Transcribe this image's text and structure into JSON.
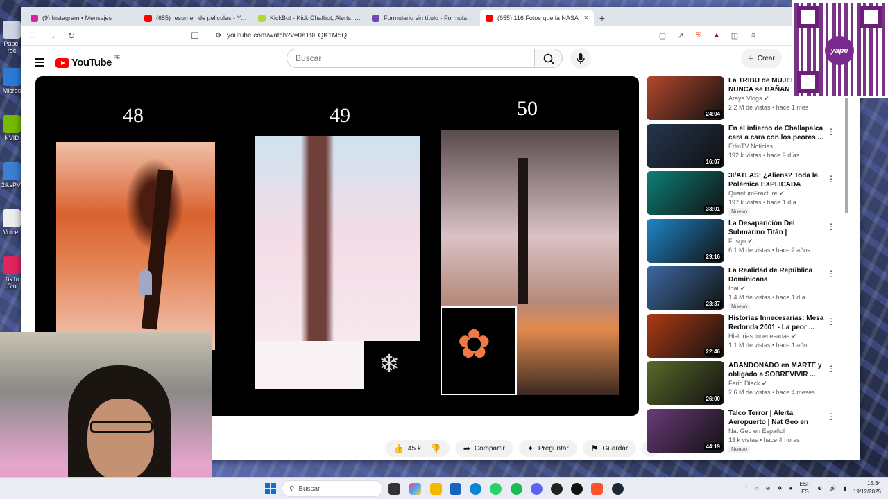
{
  "browser": {
    "tabs": [
      {
        "title": "(9) Instagram • Mensajes",
        "color": "#d6249f",
        "active": false
      },
      {
        "title": "(655) resumen de peliculas - YouTube",
        "color": "#ff0000",
        "active": false
      },
      {
        "title": "KickBot - Kick Chatbot, Alerts, TTS, Overlays",
        "color": "#b7d63d",
        "active": false
      },
      {
        "title": "Formulario sin título - Formularios de Google",
        "color": "#7248b9",
        "active": false
      },
      {
        "title": "(655) 116 Fotos que la NASA",
        "color": "#ff0000",
        "active": true
      }
    ],
    "url": "youtube.com/watch?v=0a19EQK1M5Q"
  },
  "youtube": {
    "logo_text": "YouTube",
    "country_code": "PE",
    "search_placeholder": "Buscar",
    "create_label": "Crear",
    "video": {
      "frames": [
        "48",
        "49",
        "50"
      ]
    },
    "actions": {
      "likes": "45 k",
      "share": "Compartir",
      "ask": "Preguntar",
      "save": "Guardar"
    },
    "recommendations": [
      {
        "title": "La TRIBU de MUJERES que NUNCA se BAÑAN | La...",
        "channel": "Araya Vlogs",
        "verified": true,
        "stats": "2.2 M de vistas • hace 1 mes",
        "duration": "24:04",
        "badge": "",
        "thumb": "#b4472d"
      },
      {
        "title": "En el infierno de Challapalca cara a cara con los peores ...",
        "channel": "EdinTV Noticias",
        "verified": false,
        "stats": "192 k vistas • hace 9 días",
        "duration": "16:07",
        "badge": "",
        "thumb": "#24364f"
      },
      {
        "title": "3I/ATLAS: ¿Aliens? Toda la Polémica EXPLICADA",
        "channel": "QuantumFracture",
        "verified": true,
        "stats": "197 k vistas • hace 1 día",
        "duration": "33:01",
        "badge": "Nuevo",
        "thumb": "#0d7f78"
      },
      {
        "title": "La Desaparición Del Submarino Titán | Documental Completo",
        "channel": "Fusgo",
        "verified": true,
        "stats": "6.1 M de vistas • hace 2 años",
        "duration": "29:16",
        "badge": "",
        "thumb": "#1f86c9"
      },
      {
        "title": "La Realidad de República Dominicana",
        "channel": "Ibai",
        "verified": true,
        "stats": "1.4 M de vistas • hace 1 día",
        "duration": "23:37",
        "badge": "Nuevo",
        "thumb": "#3d6aa3"
      },
      {
        "title": "Historias Innecesarias: Mesa Redonda 2001 - La peor ...",
        "channel": "Historias Innecesarias",
        "verified": true,
        "stats": "1.1 M de vistas • hace 1 año",
        "duration": "22:46",
        "badge": "",
        "thumb": "#b03a14"
      },
      {
        "title": "ABANDONADO en MARTE y obligado a SOBREVIVIR ...",
        "channel": "Farid Dieck",
        "verified": true,
        "stats": "2.6 M de vistas • hace 4 meses",
        "duration": "26:00",
        "badge": "",
        "thumb": "#5a6a2a"
      },
      {
        "title": "Talco Terror | Alerta Aeropuerto | Nat Geo en Español",
        "channel": "Nat Geo en Español",
        "verified": false,
        "stats": "13 k vistas • hace 4 horas",
        "duration": "44:19",
        "badge": "Nuevo",
        "thumb": "#6b3a79"
      }
    ]
  },
  "desktop": {
    "icons": [
      "Papel rec",
      "Micros",
      "NVID",
      "2iksPV2",
      "Voicer",
      "TikTo Stu"
    ]
  },
  "overlays": {
    "qr_logo": "yape"
  },
  "taskbar": {
    "search_placeholder": "Buscar",
    "lang_top": "ESP",
    "lang_bottom": "ES",
    "time": "15:34",
    "date": "19/12/2025"
  }
}
